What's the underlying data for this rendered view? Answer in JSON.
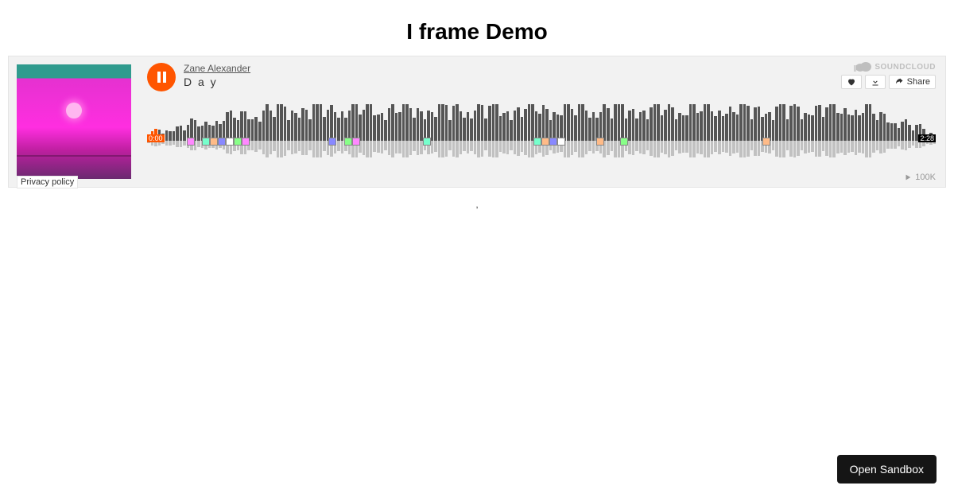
{
  "page": {
    "title": "I frame Demo",
    "stray": ","
  },
  "player": {
    "artist": "Zane Alexander",
    "track": "D a y",
    "currentTime": "0:00",
    "duration": "2:28",
    "playCount": "100K",
    "brand": "SOUNDCLOUD",
    "privacyLabel": "Privacy policy",
    "buttons": {
      "share": "Share"
    },
    "playing": true,
    "colors": {
      "accent": "#ff5500"
    },
    "markerPositions": [
      5,
      7,
      8,
      9,
      10,
      11,
      12,
      23,
      25,
      26,
      35,
      49,
      50,
      51,
      52,
      57,
      60,
      78
    ]
  },
  "footer": {
    "openSandbox": "Open Sandbox"
  }
}
